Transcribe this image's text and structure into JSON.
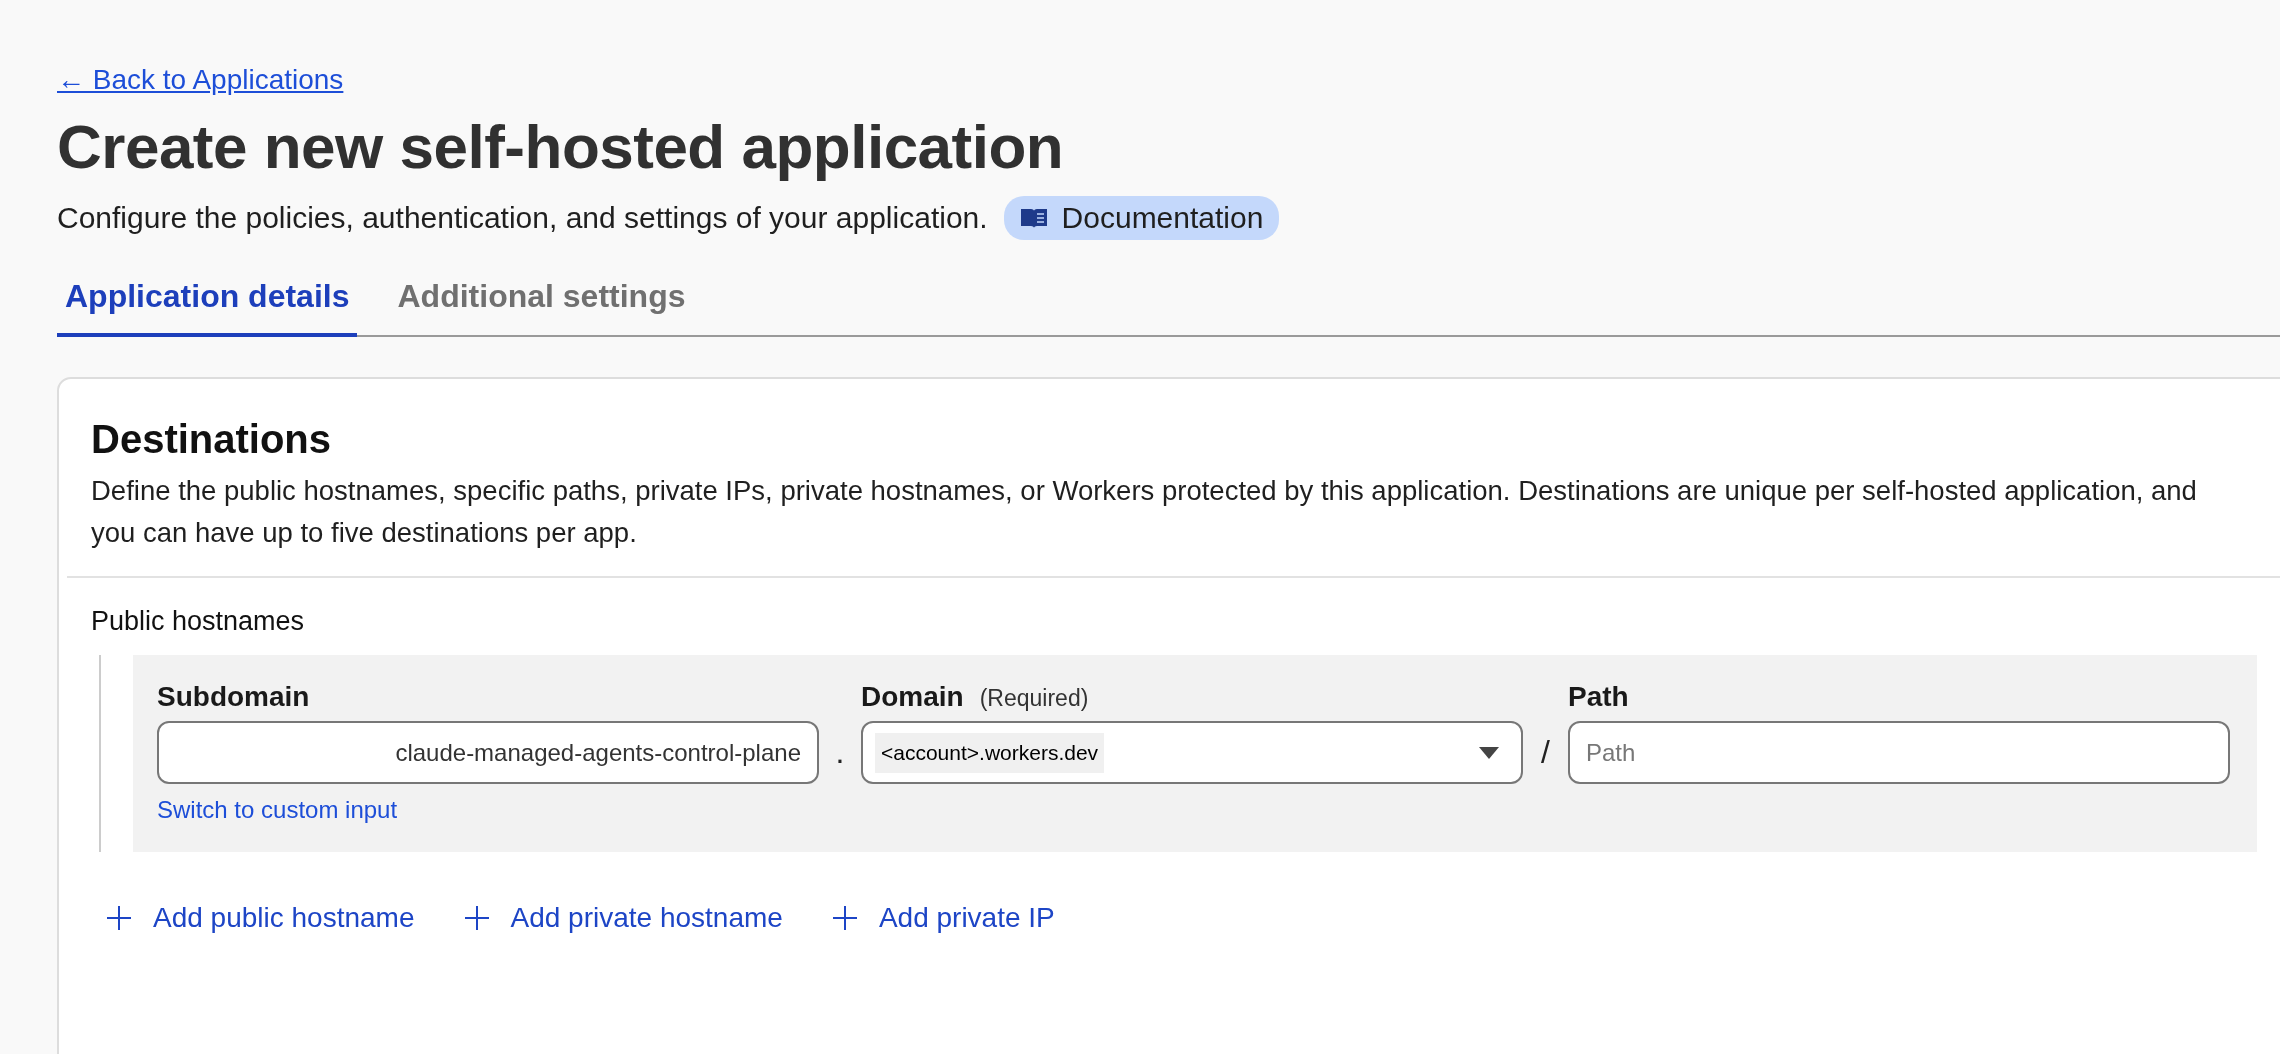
{
  "back_link": "← Back to Applications",
  "title": "Create new self-hosted application",
  "subtitle": "Configure the policies, authentication, and settings of your application.",
  "doc_badge": "Documentation",
  "tabs": [
    {
      "label": "Application details",
      "selected": true
    },
    {
      "label": "Additional settings",
      "selected": false
    }
  ],
  "destinations": {
    "title": "Destinations",
    "description": "Define the public hostnames, specific paths, private IPs, private hostnames, or Workers protected by this application. Destinations are unique per self-hosted application, and you can have up to five destinations per app.",
    "section_label": "Public hostnames",
    "hostname": {
      "subdomain": {
        "label": "Subdomain",
        "value": "claude-managed-agents-control-plane"
      },
      "dot": ".",
      "domain": {
        "label": "Domain",
        "hint": "(Required)",
        "value": "<account>.workers.dev"
      },
      "slash": "/",
      "path": {
        "label": "Path",
        "placeholder": "Path"
      },
      "switch_link": "Switch to custom input"
    },
    "add_buttons": [
      "Add public hostname",
      "Add private hostname",
      "Add private IP"
    ]
  }
}
